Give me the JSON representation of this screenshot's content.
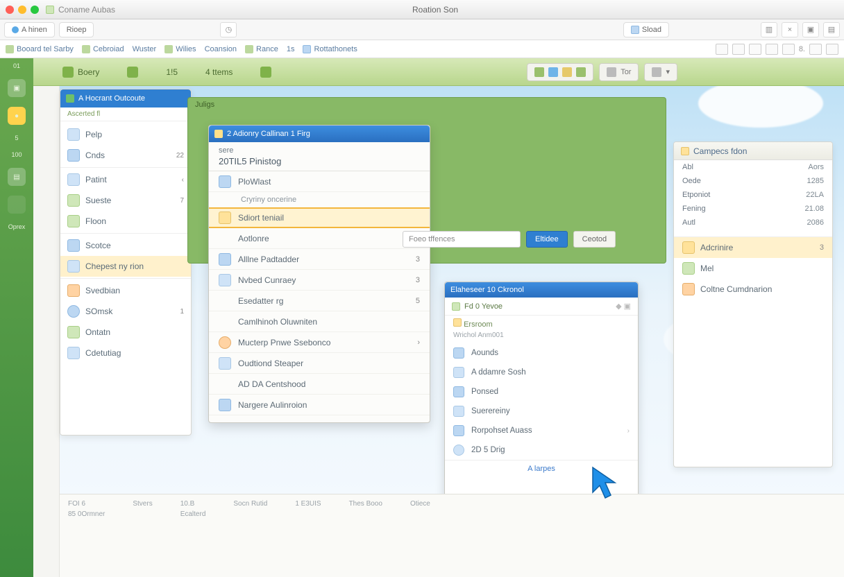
{
  "titlebar": {
    "left": "Coname Aubas",
    "center": "Roation Son"
  },
  "tabs": {
    "t1": "A hinen",
    "t2": "Rioep",
    "t3": "Sload",
    "x": "×"
  },
  "menubar": {
    "m1": "Booard tel Sarby",
    "m2": "Cebroiad",
    "m3": "Wuster",
    "m4": "Wilies",
    "m5": "Coansion",
    "m6": "Rance",
    "m7": "1s",
    "m8": "Rottathonets",
    "mr": "8."
  },
  "ribbon": {
    "r1": "Boery",
    "r2": "1!5",
    "r3": "4 ttems",
    "chip1": "Tor",
    "chip2": ""
  },
  "rail": {
    "a": "01",
    "b": "5",
    "c": "100",
    "d": "Oprex"
  },
  "panelLeft": {
    "title": "A Hocrant Outcoute",
    "subtitle": "Ascerted fl",
    "items": [
      {
        "label": "Pelp",
        "badge": ""
      },
      {
        "label": "Cnds",
        "badge": "22"
      },
      {
        "label": "Patint",
        "badge": "‹"
      },
      {
        "label": "Sueste",
        "badge": "7"
      },
      {
        "label": "Floon",
        "badge": ""
      },
      {
        "label": "Scotce",
        "badge": ""
      },
      {
        "label": "Chepest ny rion",
        "badge": ""
      },
      {
        "label": "Svedbian",
        "badge": ""
      },
      {
        "label": "SOmsk",
        "badge": "1"
      },
      {
        "label": "Ontatn",
        "badge": ""
      },
      {
        "label": "Cdetutiag",
        "badge": ""
      }
    ]
  },
  "greenWin": {
    "hdr": "Juligs"
  },
  "dlg": {
    "title": "2 Adionry Callinan 1 Firg",
    "metaSmall": "sere",
    "metaBig": "20TIL5 Pinistog",
    "rows": [
      {
        "label": "PloWlast",
        "sub": "Cryriny oncerine"
      },
      {
        "label": "Sdiort teniail",
        "highlight": true
      },
      {
        "label": "Aotlonre",
        "num": ""
      },
      {
        "label": "Alllne Padtadder",
        "num": "3"
      },
      {
        "label": "Nvbed Cunraey",
        "num": "3"
      },
      {
        "label": "Esedatter rg",
        "num": "5"
      },
      {
        "label": "Camlhinoh Oluwniten",
        "num": ""
      },
      {
        "label": "Mucterp Pnwe Ssebonco",
        "num": "›"
      },
      {
        "label": "Oudtiond Steaper",
        "num": ""
      },
      {
        "label": "AD DA Centshood",
        "num": ""
      },
      {
        "label": "Nargere Aulinroion",
        "num": ""
      }
    ]
  },
  "toolrow": {
    "field": "Foeo tffences",
    "btn1": "Eltidee",
    "btn2": "Ceotod"
  },
  "win2": {
    "title": "Elaheseer 10 Ckronol",
    "sub": "Fd 0 Yevoe",
    "cap": "Ersroom",
    "cap2": "Wrichol Anm001",
    "rows": [
      {
        "label": "Aounds"
      },
      {
        "label": "A ddamre Sosh"
      },
      {
        "label": "Ponsed"
      },
      {
        "label": "Suerereiny"
      },
      {
        "label": "Rorpohset Auass",
        "chev": "›"
      },
      {
        "label": "2D 5 Drig"
      }
    ],
    "foot": "A larpes"
  },
  "side": {
    "title": "Campecs fdon",
    "kv": [
      {
        "k": "Abl",
        "v": "Aors"
      },
      {
        "k": "Oede",
        "v": "1285"
      },
      {
        "k": "Etponiot",
        "v": "22LA"
      },
      {
        "k": "Fening",
        "v": "21.08"
      },
      {
        "k": "Autl",
        "v": "2086"
      }
    ],
    "items": [
      {
        "label": "Adcrinire",
        "num": "3"
      },
      {
        "label": "Mel"
      },
      {
        "label": "Coltne Cumdnarion"
      }
    ]
  },
  "bottom": {
    "c1a": "FOI 6",
    "c1b": "85 0Ormner",
    "c2a": "Stvers",
    "c2b": "",
    "c3a": "10.B",
    "c3b": "Ecalterd",
    "c4": "Socn Rutid",
    "c5": "1 E3UIS",
    "c6": "Thes Booo",
    "c7": "Otiece"
  }
}
